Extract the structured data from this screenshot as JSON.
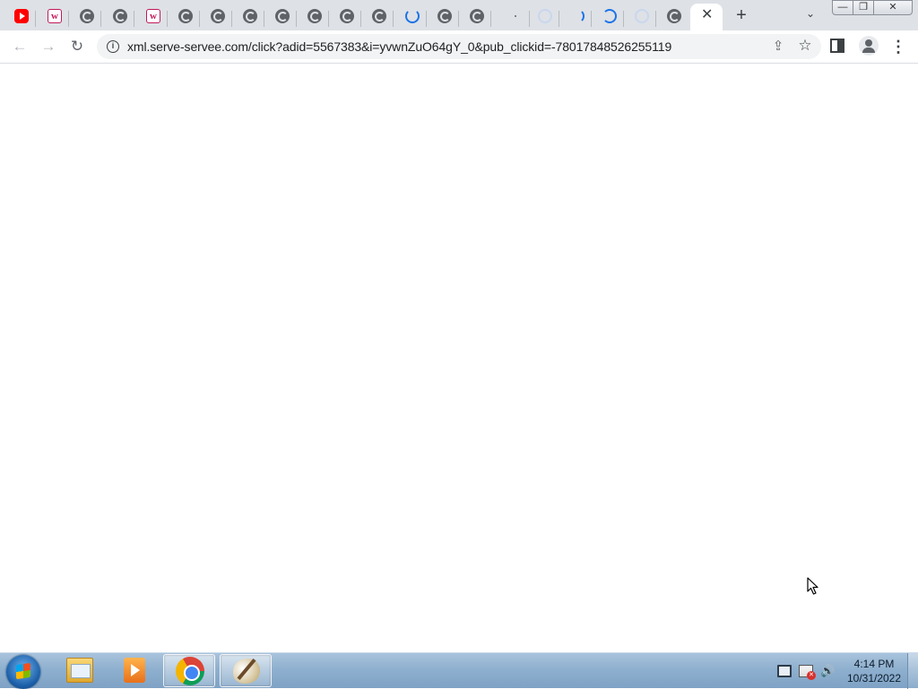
{
  "browser": {
    "tabs": [
      {
        "icon": "youtube-icon",
        "state": "inactive"
      },
      {
        "icon": "w-logo-icon",
        "state": "inactive"
      },
      {
        "icon": "globe-icon",
        "state": "inactive"
      },
      {
        "icon": "globe-icon",
        "state": "inactive"
      },
      {
        "icon": "w-logo-icon",
        "state": "inactive"
      },
      {
        "icon": "globe-icon",
        "state": "inactive"
      },
      {
        "icon": "globe-icon",
        "state": "inactive"
      },
      {
        "icon": "globe-icon",
        "state": "inactive"
      },
      {
        "icon": "globe-icon",
        "state": "inactive"
      },
      {
        "icon": "globe-icon",
        "state": "inactive"
      },
      {
        "icon": "globe-icon",
        "state": "inactive"
      },
      {
        "icon": "globe-icon",
        "state": "inactive"
      },
      {
        "icon": "loading-spinner-icon",
        "state": "loading"
      },
      {
        "icon": "globe-icon",
        "state": "inactive"
      },
      {
        "icon": "globe-icon",
        "state": "inactive"
      },
      {
        "icon": "loading-dot-icon",
        "state": "loading"
      },
      {
        "icon": "loading-spinner-icon",
        "state": "loading"
      },
      {
        "icon": "loading-spinner-icon",
        "state": "loading"
      },
      {
        "icon": "loading-spinner-icon",
        "state": "loading"
      },
      {
        "icon": "loading-spinner-icon",
        "state": "loading"
      },
      {
        "icon": "globe-icon",
        "state": "inactive"
      },
      {
        "icon": "close-icon",
        "state": "active"
      }
    ],
    "active_tab_close": "✕",
    "new_tab_label": "+",
    "tab_search_glyph": "⌄",
    "window_controls": {
      "minimize": "—",
      "maximize": "❐",
      "close": "✕"
    },
    "nav": {
      "back": "←",
      "forward": "→",
      "reload": "↻"
    },
    "address_bar": {
      "info_glyph": "i",
      "url": "xml.serve-servee.com/click?adid=5567383&i=yvwnZuO64gY_0&pub_clickid=-78017848526255119"
    },
    "toolbar_icons": {
      "share": "⇪",
      "bookmark": "☆",
      "menu": "⋮"
    }
  },
  "taskbar": {
    "apps": [
      {
        "name": "windows-explorer",
        "active": false
      },
      {
        "name": "windows-media-player",
        "active": false
      },
      {
        "name": "google-chrome",
        "active": true
      },
      {
        "name": "paint",
        "active": false
      }
    ],
    "tray": {
      "volume_glyph": "🔊"
    },
    "clock": {
      "time": "4:14 PM",
      "date": "10/31/2022"
    }
  },
  "colors": {
    "tabstrip_bg": "#dee1e6",
    "omnibox_bg": "#f1f3f4",
    "loading_accent": "#1a73e8",
    "taskbar_bg": "#8fb0cf"
  }
}
